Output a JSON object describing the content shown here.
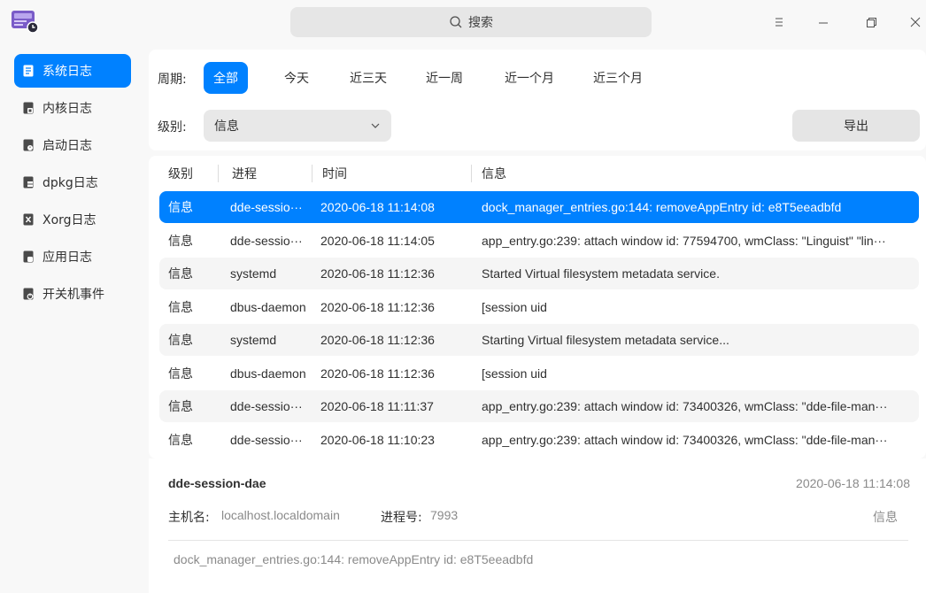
{
  "titlebar": {
    "search_label": "搜索",
    "icons": [
      "app-logo-icon",
      "search-icon",
      "menu-icon",
      "minimize-icon",
      "maximize-icon",
      "close-icon"
    ]
  },
  "sidebar": {
    "items": [
      {
        "label": "系统日志",
        "icon": "system-log-icon",
        "active": true
      },
      {
        "label": "内核日志",
        "icon": "kernel-log-icon"
      },
      {
        "label": "启动日志",
        "icon": "boot-log-icon"
      },
      {
        "label": "dpkg日志",
        "icon": "dpkg-log-icon"
      },
      {
        "label": "Xorg日志",
        "icon": "xorg-log-icon"
      },
      {
        "label": "应用日志",
        "icon": "app-log-icon"
      },
      {
        "label": "开关机事件",
        "icon": "power-event-icon"
      }
    ]
  },
  "filter": {
    "period_label": "周期:",
    "periods": [
      "全部",
      "今天",
      "近三天",
      "近一周",
      "近一个月",
      "近三个月"
    ],
    "level_label": "级别:",
    "level_value": "信息",
    "export_label": "导出"
  },
  "table": {
    "headers": [
      "级别",
      "进程",
      "时间",
      "信息"
    ],
    "rows": [
      {
        "level": "信息",
        "process": "dde-sessio···",
        "time": "2020-06-18 11:14:08",
        "info": "dock_manager_entries.go:144: removeAppEntry id: e8T5eeadbfd"
      },
      {
        "level": "信息",
        "process": "dde-sessio···",
        "time": "2020-06-18 11:14:05",
        "info": "app_entry.go:239: attach window id: 77594700, wmClass: \"Linguist\" \"lin···"
      },
      {
        "level": "信息",
        "process": "systemd",
        "time": "2020-06-18 11:12:36",
        "info": "Started Virtual filesystem metadata service."
      },
      {
        "level": "信息",
        "process": "dbus-daemon",
        "time": "2020-06-18 11:12:36",
        "info": "[session uid"
      },
      {
        "level": "信息",
        "process": "systemd",
        "time": "2020-06-18 11:12:36",
        "info": "Starting Virtual filesystem metadata service..."
      },
      {
        "level": "信息",
        "process": "dbus-daemon",
        "time": "2020-06-18 11:12:36",
        "info": "[session uid"
      },
      {
        "level": "信息",
        "process": "dde-sessio···",
        "time": "2020-06-18 11:11:37",
        "info": "app_entry.go:239: attach window id: 73400326, wmClass: \"dde-file-man···"
      },
      {
        "level": "信息",
        "process": "dde-sessio···",
        "time": "2020-06-18 11:10:23",
        "info": "app_entry.go:239: attach window id: 73400326, wmClass: \"dde-file-man···"
      }
    ]
  },
  "detail": {
    "process": "dde-session-dae",
    "time": "2020-06-18 11:14:08",
    "host_label": "主机名:",
    "host_value": "localhost.localdomain",
    "pid_label": "进程号:",
    "pid_value": "7993",
    "level": "信息",
    "message": "dock_manager_entries.go:144: removeAppEntry id: e8T5eeadbfd"
  },
  "colors": {
    "accent": "#0081ff",
    "background": "#f8f8f8",
    "panel": "#ffffff"
  }
}
